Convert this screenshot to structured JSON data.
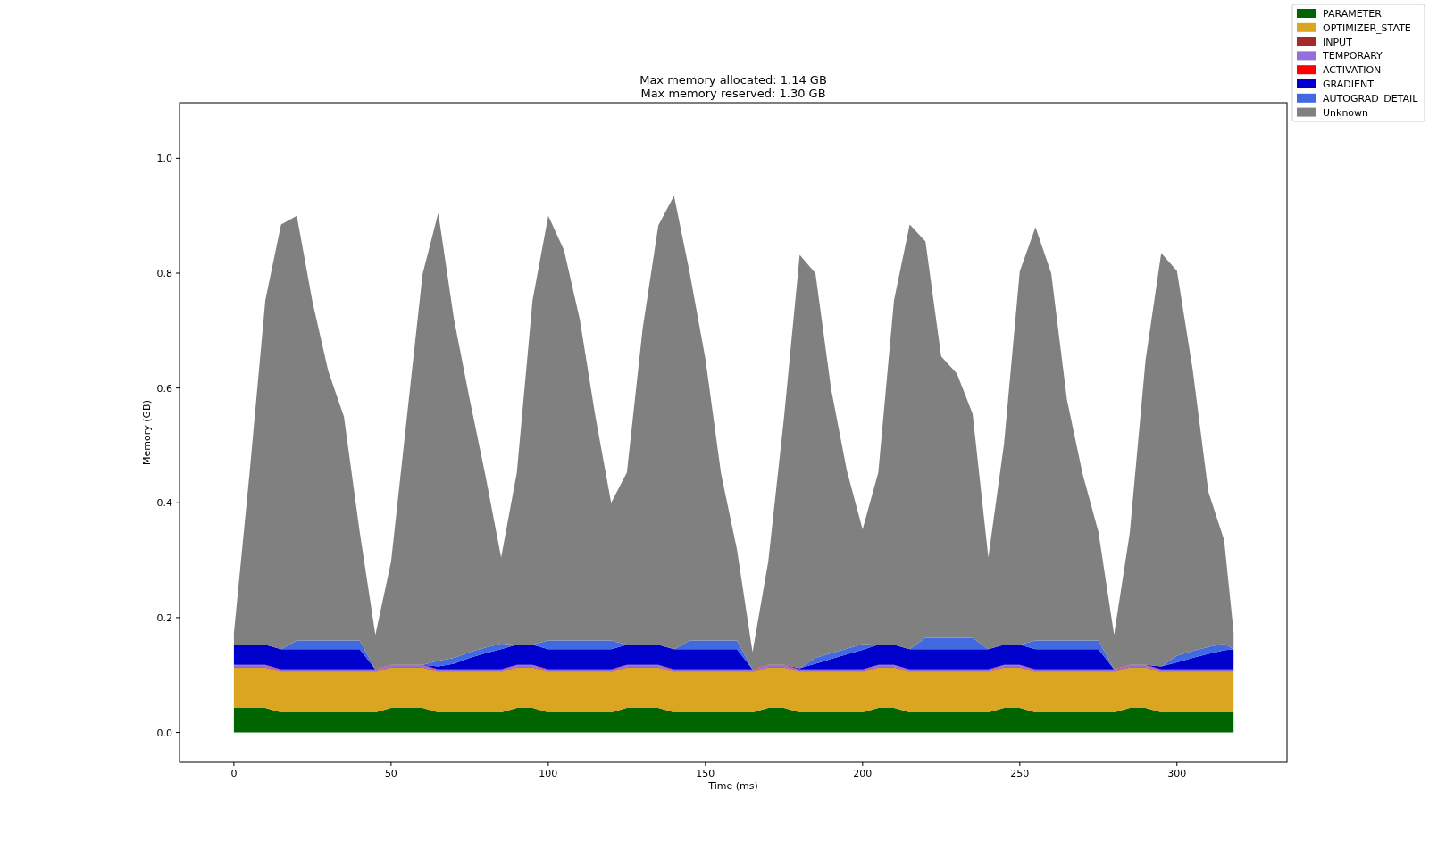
{
  "figure": {
    "chart_data": {
      "type": "area",
      "title": "Max memory allocated: 1.14 GB\nMax memory reserved: 1.30 GB",
      "xlabel": "Time (ms)",
      "ylabel": "Memory (GB)",
      "stacked": true,
      "legend": "upper right",
      "xlim": [
        -17.3,
        335
      ],
      "ylim": [
        -0.052,
        1.097
      ],
      "xticks": [
        0,
        50,
        100,
        150,
        200,
        250,
        300
      ],
      "yticks": [
        {
          "value": 0,
          "label": "0.0"
        },
        {
          "value": 0.2,
          "label": "0.2"
        },
        {
          "value": 0.4,
          "label": "0.4"
        },
        {
          "value": 0.6,
          "label": "0.6"
        },
        {
          "value": 0.8,
          "label": "0.8"
        },
        {
          "value": 1.0,
          "label": "1.0"
        }
      ],
      "x": [
        0,
        5,
        10,
        15,
        20,
        25,
        30,
        35,
        40,
        45,
        50,
        55,
        60,
        65,
        70,
        75,
        80,
        85,
        90,
        95,
        100,
        105,
        110,
        115,
        120,
        125,
        130,
        135,
        140,
        145,
        150,
        155,
        160,
        165,
        170,
        175,
        180,
        185,
        190,
        195,
        200,
        205,
        210,
        215,
        220,
        225,
        230,
        235,
        240,
        245,
        250,
        255,
        260,
        265,
        270,
        275,
        280,
        285,
        290,
        295,
        300,
        305,
        310,
        315,
        318
      ],
      "series": [
        {
          "name": "PARAMETER",
          "color": "#006400",
          "values": [
            0.043,
            0.043,
            0.043,
            0.035,
            0.035,
            0.035,
            0.035,
            0.035,
            0.035,
            0.035,
            0.043,
            0.043,
            0.043,
            0.035,
            0.035,
            0.035,
            0.035,
            0.035,
            0.043,
            0.043,
            0.035,
            0.035,
            0.035,
            0.035,
            0.035,
            0.043,
            0.043,
            0.043,
            0.035,
            0.035,
            0.035,
            0.035,
            0.035,
            0.035,
            0.043,
            0.043,
            0.035,
            0.035,
            0.035,
            0.035,
            0.035,
            0.043,
            0.043,
            0.035,
            0.035,
            0.035,
            0.035,
            0.035,
            0.035,
            0.043,
            0.043,
            0.035,
            0.035,
            0.035,
            0.035,
            0.035,
            0.035,
            0.043,
            0.043,
            0.035,
            0.035,
            0.035,
            0.035,
            0.035,
            0.035
          ]
        },
        {
          "name": "OPTIMIZER_STATE",
          "color": "#daa520",
          "values": [
            0.07,
            0.07,
            0.07,
            0.07,
            0.07,
            0.07,
            0.07,
            0.07,
            0.07,
            0.07,
            0.07,
            0.07,
            0.07,
            0.07,
            0.07,
            0.07,
            0.07,
            0.07,
            0.07,
            0.07,
            0.07,
            0.07,
            0.07,
            0.07,
            0.07,
            0.07,
            0.07,
            0.07,
            0.07,
            0.07,
            0.07,
            0.07,
            0.07,
            0.07,
            0.07,
            0.07,
            0.07,
            0.07,
            0.07,
            0.07,
            0.07,
            0.07,
            0.07,
            0.07,
            0.07,
            0.07,
            0.07,
            0.07,
            0.07,
            0.07,
            0.07,
            0.07,
            0.07,
            0.07,
            0.07,
            0.07,
            0.07,
            0.07,
            0.07,
            0.07,
            0.07,
            0.07,
            0.07,
            0.07,
            0.07
          ]
        },
        {
          "name": "INPUT",
          "color": "#a52a2a",
          "values": [
            0.001,
            0.001,
            0.001,
            0.001,
            0.001,
            0.001,
            0.001,
            0.001,
            0.001,
            0.001,
            0.001,
            0.001,
            0.001,
            0.001,
            0.001,
            0.001,
            0.001,
            0.001,
            0.001,
            0.001,
            0.001,
            0.001,
            0.001,
            0.001,
            0.001,
            0.001,
            0.001,
            0.001,
            0.001,
            0.001,
            0.001,
            0.001,
            0.001,
            0.001,
            0.001,
            0.001,
            0.001,
            0.001,
            0.001,
            0.001,
            0.001,
            0.001,
            0.001,
            0.001,
            0.001,
            0.001,
            0.001,
            0.001,
            0.001,
            0.001,
            0.001,
            0.001,
            0.001,
            0.001,
            0.001,
            0.001,
            0.001,
            0.001,
            0.001,
            0.001,
            0.001,
            0.001,
            0.001,
            0.001,
            0.001
          ]
        },
        {
          "name": "TEMPORARY",
          "color": "#9370db",
          "values": [
            0.003,
            0.003,
            0.003,
            0.003,
            0.003,
            0.003,
            0.003,
            0.003,
            0.003,
            0.003,
            0.003,
            0.003,
            0.003,
            0.003,
            0.003,
            0.003,
            0.003,
            0.003,
            0.003,
            0.003,
            0.003,
            0.003,
            0.003,
            0.003,
            0.003,
            0.003,
            0.003,
            0.003,
            0.003,
            0.003,
            0.003,
            0.003,
            0.003,
            0.003,
            0.003,
            0.003,
            0.003,
            0.003,
            0.003,
            0.003,
            0.003,
            0.003,
            0.003,
            0.003,
            0.003,
            0.003,
            0.003,
            0.003,
            0.003,
            0.003,
            0.003,
            0.003,
            0.003,
            0.003,
            0.003,
            0.003,
            0.003,
            0.003,
            0.003,
            0.003,
            0.003,
            0.003,
            0.003,
            0.003,
            0.003
          ]
        },
        {
          "name": "ACTIVATION",
          "color": "#ff0000",
          "values": [
            0.001,
            0.001,
            0.001,
            0.001,
            0.001,
            0.001,
            0.001,
            0.001,
            0.001,
            0.001,
            0.001,
            0.001,
            0.001,
            0.001,
            0.001,
            0.001,
            0.001,
            0.001,
            0.001,
            0.001,
            0.001,
            0.001,
            0.001,
            0.001,
            0.001,
            0.001,
            0.001,
            0.001,
            0.001,
            0.001,
            0.001,
            0.001,
            0.001,
            0.001,
            0.001,
            0.001,
            0.001,
            0.001,
            0.001,
            0.001,
            0.001,
            0.001,
            0.001,
            0.001,
            0.001,
            0.001,
            0.001,
            0.001,
            0.001,
            0.001,
            0.001,
            0.001,
            0.001,
            0.001,
            0.001,
            0.001,
            0.001,
            0.001,
            0.001,
            0.001,
            0.001,
            0.001,
            0.001,
            0.001,
            0.001
          ]
        },
        {
          "name": "GRADIENT",
          "color": "#0000cd",
          "values": [
            0.035,
            0.035,
            0.035,
            0.035,
            0.035,
            0.035,
            0.035,
            0.035,
            0.035,
            0,
            0,
            0,
            0,
            0.005,
            0.01,
            0.02,
            0.028,
            0.035,
            0.035,
            0.035,
            0.035,
            0.035,
            0.035,
            0.035,
            0.035,
            0.035,
            0.035,
            0.035,
            0.035,
            0.035,
            0.035,
            0.035,
            0.035,
            0,
            0,
            0,
            0.002,
            0.01,
            0.018,
            0.026,
            0.034,
            0.035,
            0.035,
            0.035,
            0.035,
            0.035,
            0.035,
            0.035,
            0.035,
            0.035,
            0.035,
            0.035,
            0.035,
            0.035,
            0.035,
            0.035,
            0,
            0,
            0,
            0.005,
            0.012,
            0.02,
            0.027,
            0.033,
            0.035
          ]
        },
        {
          "name": "AUTOGRAD_DETAIL",
          "color": "#4169e1",
          "values": [
            0,
            0,
            0,
            0,
            0.015,
            0.015,
            0.015,
            0.015,
            0.015,
            0,
            0,
            0,
            0,
            0.01,
            0.01,
            0.01,
            0.01,
            0.01,
            0,
            0,
            0.015,
            0.015,
            0.015,
            0.015,
            0.015,
            0,
            0,
            0,
            0,
            0.015,
            0.015,
            0.015,
            0.015,
            0,
            0,
            0,
            0,
            0.01,
            0.01,
            0.01,
            0.01,
            0,
            0,
            0,
            0.02,
            0.02,
            0.02,
            0.02,
            0,
            0,
            0,
            0.015,
            0.015,
            0.015,
            0.015,
            0.015,
            0,
            0,
            0,
            0,
            0.012,
            0.012,
            0.012,
            0.012,
            0
          ]
        },
        {
          "name": "Unknown",
          "color": "#808080",
          "values": [
            0.02,
            0.3,
            0.6,
            0.74,
            0.74,
            0.59,
            0.47,
            0.39,
            0.19,
            0.06,
            0.18,
            0.43,
            0.68,
            0.78,
            0.59,
            0.44,
            0.3,
            0.15,
            0.3,
            0.6,
            0.74,
            0.68,
            0.56,
            0.39,
            0.24,
            0.3,
            0.55,
            0.73,
            0.79,
            0.64,
            0.49,
            0.29,
            0.16,
            0.03,
            0.18,
            0.43,
            0.72,
            0.67,
            0.46,
            0.31,
            0.2,
            0.3,
            0.6,
            0.74,
            0.69,
            0.49,
            0.46,
            0.39,
            0.16,
            0.35,
            0.65,
            0.72,
            0.64,
            0.42,
            0.29,
            0.19,
            0.06,
            0.23,
            0.53,
            0.72,
            0.67,
            0.49,
            0.27,
            0.18,
            0.03
          ]
        }
      ]
    }
  }
}
